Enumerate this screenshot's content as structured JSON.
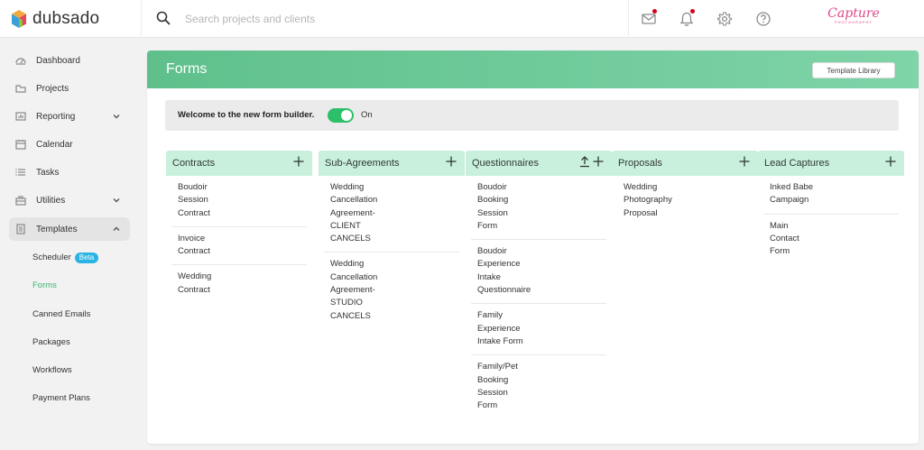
{
  "app": {
    "name": "dubsado"
  },
  "search": {
    "placeholder": "Search projects and clients"
  },
  "brand": {
    "name": "Capture",
    "tagline": "PHOTOGRAPHY"
  },
  "top_icons": [
    "mail-icon",
    "bell-icon",
    "gear-icon",
    "help-icon"
  ],
  "sidebar": {
    "items": [
      {
        "label": "Dashboard",
        "icon": "dashboard-icon"
      },
      {
        "label": "Projects",
        "icon": "projects-icon"
      },
      {
        "label": "Reporting",
        "icon": "reporting-icon",
        "chevron": "down"
      },
      {
        "label": "Calendar",
        "icon": "calendar-icon"
      },
      {
        "label": "Tasks",
        "icon": "tasks-icon"
      },
      {
        "label": "Utilities",
        "icon": "utilities-icon",
        "chevron": "down"
      },
      {
        "label": "Templates",
        "icon": "templates-icon",
        "chevron": "up",
        "active": true
      }
    ],
    "subitems": [
      {
        "label": "Scheduler",
        "badge": "Beta"
      },
      {
        "label": "Forms",
        "current": true
      },
      {
        "label": "Canned Emails"
      },
      {
        "label": "Packages"
      },
      {
        "label": "Workflows"
      },
      {
        "label": "Payment Plans"
      }
    ]
  },
  "main": {
    "title": "Forms",
    "library_button": "Template Library",
    "welcome": {
      "text": "Welcome to the new form builder.",
      "toggle_state": "On",
      "toggle_on": true
    },
    "columns": [
      {
        "title": "Contracts",
        "items": [
          [
            "Boudoir",
            "Session",
            "Contract"
          ],
          [
            "Invoice",
            "Contract"
          ],
          [
            "Wedding",
            "Contract"
          ]
        ]
      },
      {
        "title": "Sub-Agreements",
        "items": [
          [
            "Wedding",
            "Cancellation",
            "Agreement-",
            "CLIENT",
            "CANCELS"
          ],
          [
            "Wedding",
            "Cancellation",
            "Agreement-",
            "STUDIO",
            "CANCELS"
          ]
        ]
      },
      {
        "title": "Questionnaires",
        "upload": true,
        "items": [
          [
            "Boudoir",
            "Booking",
            "Session",
            "Form"
          ],
          [
            "Boudoir",
            "Experience",
            "Intake",
            "Questionnaire"
          ],
          [
            "Family",
            "Experience",
            "Intake Form"
          ],
          [
            "Family/Pet",
            "Booking",
            "Session",
            "Form"
          ]
        ]
      },
      {
        "title": "Proposals",
        "items": [
          [
            "Wedding",
            "Photography",
            "Proposal"
          ]
        ]
      },
      {
        "title": "Lead Captures",
        "items": [
          [
            "Inked Babe",
            "Campaign"
          ],
          [
            "Main",
            "Contact",
            "Form"
          ]
        ]
      }
    ]
  },
  "colors": {
    "accent": "#3cb371",
    "header_from": "#5fc08c",
    "header_to": "#7fd4a8",
    "column_head": "#c9f0dc",
    "toggle": "#2ebf6b",
    "beta": "#2ab4e6",
    "notify": "#d0021b"
  }
}
